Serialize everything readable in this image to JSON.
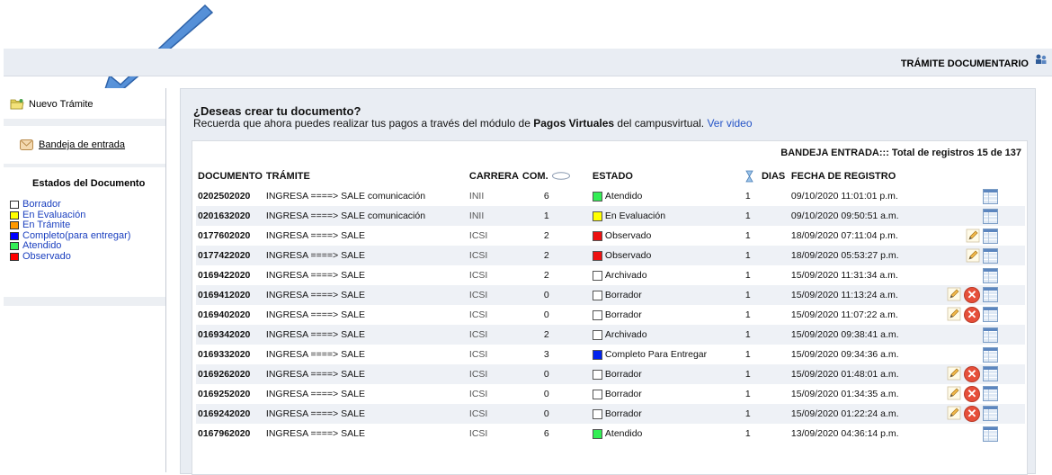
{
  "header": {
    "title": "TRÁMITE DOCUMENTARIO"
  },
  "sidebar": {
    "new_label": "Nuevo Trámite",
    "inbox_label": "Bandeja de entrada",
    "states_title": "Estados del Documento",
    "legend": [
      {
        "label": "Borrador",
        "color": "#ffffff"
      },
      {
        "label": "En Evaluación",
        "color": "#ffff00"
      },
      {
        "label": "En Trámite",
        "color": "#ff9900"
      },
      {
        "label": "Completo(para entregar)",
        "color": "#0000ff"
      },
      {
        "label": "Atendido",
        "color": "#33ee55"
      },
      {
        "label": "Observado",
        "color": "#ff0000"
      }
    ]
  },
  "main": {
    "question": "¿Deseas crear tu documento?",
    "sub_prefix": "Recuerda que ahora puedes realizar tus pagos a través del módulo de ",
    "sub_bold": "Pagos Virtuales",
    "sub_suffix": " del campusvirtual. ",
    "video_link": "Ver video",
    "count_text": "BANDEJA ENTRADA::: Total de registros 15 de 137",
    "columns": {
      "documento": "DOCUMENTO",
      "tramite": "TRÁMITE",
      "carrera": "CARRERA",
      "com": "COM.",
      "estado": "ESTADO",
      "dias": "DIAS",
      "fecha": "FECHA DE REGISTRO"
    },
    "rows": [
      {
        "doc": "0202502020",
        "tramite": "INGRESA ====> SALE comunicación",
        "carrera": "INII",
        "com": "6",
        "estado": "Atendido",
        "color": "#33ee55",
        "dias": "1",
        "fecha": "09/10/2020 11:01:01 p.m.",
        "actions": [
          "cal"
        ]
      },
      {
        "doc": "0201632020",
        "tramite": "INGRESA ====> SALE comunicación",
        "carrera": "INII",
        "com": "1",
        "estado": "En Evaluación",
        "color": "#ffff00",
        "dias": "1",
        "fecha": "09/10/2020 09:50:51 a.m.",
        "actions": [
          "cal"
        ]
      },
      {
        "doc": "0177602020",
        "tramite": "INGRESA ====> SALE",
        "carrera": "ICSI",
        "com": "2",
        "estado": "Observado",
        "color": "#ee1111",
        "dias": "1",
        "fecha": "18/09/2020 07:11:04 p.m.",
        "actions": [
          "edit",
          "cal"
        ]
      },
      {
        "doc": "0177422020",
        "tramite": "INGRESA ====> SALE",
        "carrera": "ICSI",
        "com": "2",
        "estado": "Observado",
        "color": "#ee1111",
        "dias": "1",
        "fecha": "18/09/2020 05:53:27 p.m.",
        "actions": [
          "edit",
          "cal"
        ]
      },
      {
        "doc": "0169422020",
        "tramite": "INGRESA ====> SALE",
        "carrera": "ICSI",
        "com": "2",
        "estado": "Archivado",
        "color": "#ffffff",
        "dias": "1",
        "fecha": "15/09/2020 11:31:34 a.m.",
        "actions": [
          "cal"
        ]
      },
      {
        "doc": "0169412020",
        "tramite": "INGRESA ====> SALE",
        "carrera": "ICSI",
        "com": "0",
        "estado": "Borrador",
        "color": "#ffffff",
        "dias": "1",
        "fecha": "15/09/2020 11:13:24 a.m.",
        "actions": [
          "edit",
          "delete",
          "cal"
        ]
      },
      {
        "doc": "0169402020",
        "tramite": "INGRESA ====> SALE",
        "carrera": "ICSI",
        "com": "0",
        "estado": "Borrador",
        "color": "#ffffff",
        "dias": "1",
        "fecha": "15/09/2020 11:07:22 a.m.",
        "actions": [
          "edit",
          "delete",
          "cal"
        ]
      },
      {
        "doc": "0169342020",
        "tramite": "INGRESA ====> SALE",
        "carrera": "ICSI",
        "com": "2",
        "estado": "Archivado",
        "color": "#ffffff",
        "dias": "1",
        "fecha": "15/09/2020 09:38:41 a.m.",
        "actions": [
          "cal"
        ]
      },
      {
        "doc": "0169332020",
        "tramite": "INGRESA ====> SALE",
        "carrera": "ICSI",
        "com": "3",
        "estado": "Completo Para Entregar",
        "color": "#0022ee",
        "dias": "1",
        "fecha": "15/09/2020 09:34:36 a.m.",
        "actions": [
          "cal"
        ]
      },
      {
        "doc": "0169262020",
        "tramite": "INGRESA ====> SALE",
        "carrera": "ICSI",
        "com": "0",
        "estado": "Borrador",
        "color": "#ffffff",
        "dias": "1",
        "fecha": "15/09/2020 01:48:01 a.m.",
        "actions": [
          "edit",
          "delete",
          "cal"
        ]
      },
      {
        "doc": "0169252020",
        "tramite": "INGRESA ====> SALE",
        "carrera": "ICSI",
        "com": "0",
        "estado": "Borrador",
        "color": "#ffffff",
        "dias": "1",
        "fecha": "15/09/2020 01:34:35 a.m.",
        "actions": [
          "edit",
          "delete",
          "cal"
        ]
      },
      {
        "doc": "0169242020",
        "tramite": "INGRESA ====> SALE",
        "carrera": "ICSI",
        "com": "0",
        "estado": "Borrador",
        "color": "#ffffff",
        "dias": "1",
        "fecha": "15/09/2020 01:22:24 a.m.",
        "actions": [
          "edit",
          "delete",
          "cal"
        ]
      },
      {
        "doc": "0167962020",
        "tramite": "INGRESA ====> SALE",
        "carrera": "ICSI",
        "com": "6",
        "estado": "Atendido",
        "color": "#33ee55",
        "dias": "1",
        "fecha": "13/09/2020 04:36:14 p.m.",
        "actions": [
          "cal"
        ]
      }
    ]
  }
}
